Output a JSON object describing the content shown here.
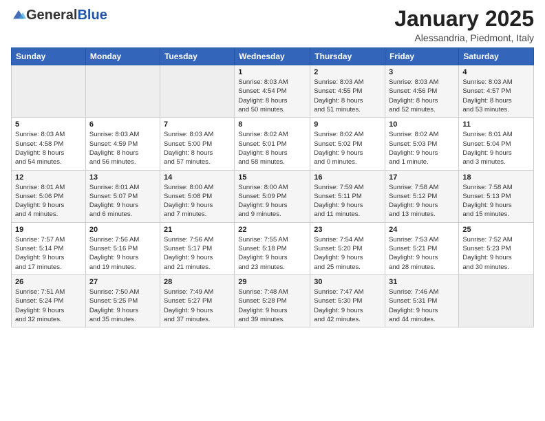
{
  "header": {
    "logo_general": "General",
    "logo_blue": "Blue",
    "month": "January 2025",
    "location": "Alessandria, Piedmont, Italy"
  },
  "days_of_week": [
    "Sunday",
    "Monday",
    "Tuesday",
    "Wednesday",
    "Thursday",
    "Friday",
    "Saturday"
  ],
  "weeks": [
    [
      {
        "day": "",
        "info": ""
      },
      {
        "day": "",
        "info": ""
      },
      {
        "day": "",
        "info": ""
      },
      {
        "day": "1",
        "info": "Sunrise: 8:03 AM\nSunset: 4:54 PM\nDaylight: 8 hours\nand 50 minutes."
      },
      {
        "day": "2",
        "info": "Sunrise: 8:03 AM\nSunset: 4:55 PM\nDaylight: 8 hours\nand 51 minutes."
      },
      {
        "day": "3",
        "info": "Sunrise: 8:03 AM\nSunset: 4:56 PM\nDaylight: 8 hours\nand 52 minutes."
      },
      {
        "day": "4",
        "info": "Sunrise: 8:03 AM\nSunset: 4:57 PM\nDaylight: 8 hours\nand 53 minutes."
      }
    ],
    [
      {
        "day": "5",
        "info": "Sunrise: 8:03 AM\nSunset: 4:58 PM\nDaylight: 8 hours\nand 54 minutes."
      },
      {
        "day": "6",
        "info": "Sunrise: 8:03 AM\nSunset: 4:59 PM\nDaylight: 8 hours\nand 56 minutes."
      },
      {
        "day": "7",
        "info": "Sunrise: 8:03 AM\nSunset: 5:00 PM\nDaylight: 8 hours\nand 57 minutes."
      },
      {
        "day": "8",
        "info": "Sunrise: 8:02 AM\nSunset: 5:01 PM\nDaylight: 8 hours\nand 58 minutes."
      },
      {
        "day": "9",
        "info": "Sunrise: 8:02 AM\nSunset: 5:02 PM\nDaylight: 9 hours\nand 0 minutes."
      },
      {
        "day": "10",
        "info": "Sunrise: 8:02 AM\nSunset: 5:03 PM\nDaylight: 9 hours\nand 1 minute."
      },
      {
        "day": "11",
        "info": "Sunrise: 8:01 AM\nSunset: 5:04 PM\nDaylight: 9 hours\nand 3 minutes."
      }
    ],
    [
      {
        "day": "12",
        "info": "Sunrise: 8:01 AM\nSunset: 5:06 PM\nDaylight: 9 hours\nand 4 minutes."
      },
      {
        "day": "13",
        "info": "Sunrise: 8:01 AM\nSunset: 5:07 PM\nDaylight: 9 hours\nand 6 minutes."
      },
      {
        "day": "14",
        "info": "Sunrise: 8:00 AM\nSunset: 5:08 PM\nDaylight: 9 hours\nand 7 minutes."
      },
      {
        "day": "15",
        "info": "Sunrise: 8:00 AM\nSunset: 5:09 PM\nDaylight: 9 hours\nand 9 minutes."
      },
      {
        "day": "16",
        "info": "Sunrise: 7:59 AM\nSunset: 5:11 PM\nDaylight: 9 hours\nand 11 minutes."
      },
      {
        "day": "17",
        "info": "Sunrise: 7:58 AM\nSunset: 5:12 PM\nDaylight: 9 hours\nand 13 minutes."
      },
      {
        "day": "18",
        "info": "Sunrise: 7:58 AM\nSunset: 5:13 PM\nDaylight: 9 hours\nand 15 minutes."
      }
    ],
    [
      {
        "day": "19",
        "info": "Sunrise: 7:57 AM\nSunset: 5:14 PM\nDaylight: 9 hours\nand 17 minutes."
      },
      {
        "day": "20",
        "info": "Sunrise: 7:56 AM\nSunset: 5:16 PM\nDaylight: 9 hours\nand 19 minutes."
      },
      {
        "day": "21",
        "info": "Sunrise: 7:56 AM\nSunset: 5:17 PM\nDaylight: 9 hours\nand 21 minutes."
      },
      {
        "day": "22",
        "info": "Sunrise: 7:55 AM\nSunset: 5:18 PM\nDaylight: 9 hours\nand 23 minutes."
      },
      {
        "day": "23",
        "info": "Sunrise: 7:54 AM\nSunset: 5:20 PM\nDaylight: 9 hours\nand 25 minutes."
      },
      {
        "day": "24",
        "info": "Sunrise: 7:53 AM\nSunset: 5:21 PM\nDaylight: 9 hours\nand 28 minutes."
      },
      {
        "day": "25",
        "info": "Sunrise: 7:52 AM\nSunset: 5:23 PM\nDaylight: 9 hours\nand 30 minutes."
      }
    ],
    [
      {
        "day": "26",
        "info": "Sunrise: 7:51 AM\nSunset: 5:24 PM\nDaylight: 9 hours\nand 32 minutes."
      },
      {
        "day": "27",
        "info": "Sunrise: 7:50 AM\nSunset: 5:25 PM\nDaylight: 9 hours\nand 35 minutes."
      },
      {
        "day": "28",
        "info": "Sunrise: 7:49 AM\nSunset: 5:27 PM\nDaylight: 9 hours\nand 37 minutes."
      },
      {
        "day": "29",
        "info": "Sunrise: 7:48 AM\nSunset: 5:28 PM\nDaylight: 9 hours\nand 39 minutes."
      },
      {
        "day": "30",
        "info": "Sunrise: 7:47 AM\nSunset: 5:30 PM\nDaylight: 9 hours\nand 42 minutes."
      },
      {
        "day": "31",
        "info": "Sunrise: 7:46 AM\nSunset: 5:31 PM\nDaylight: 9 hours\nand 44 minutes."
      },
      {
        "day": "",
        "info": ""
      }
    ]
  ]
}
